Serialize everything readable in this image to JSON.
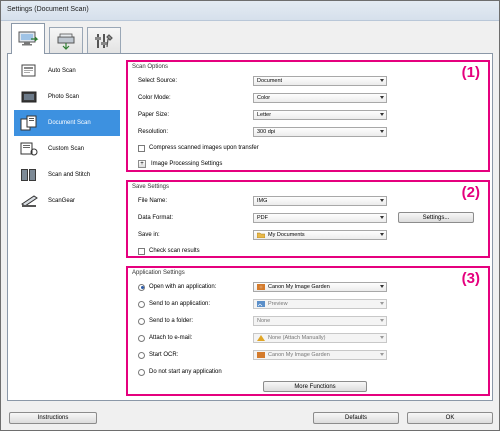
{
  "window": {
    "title": "Settings (Document Scan)"
  },
  "tabs": [
    {
      "icon": "scan-from-computer-icon",
      "active": true
    },
    {
      "icon": "scan-from-panel-icon",
      "active": false
    },
    {
      "icon": "general-settings-icon",
      "active": false
    }
  ],
  "sidebar": {
    "items": [
      {
        "label": "Auto Scan",
        "icon": "auto-scan-icon",
        "selected": false
      },
      {
        "label": "Photo Scan",
        "icon": "photo-scan-icon",
        "selected": false
      },
      {
        "label": "Document Scan",
        "icon": "document-scan-icon",
        "selected": true
      },
      {
        "label": "Custom Scan",
        "icon": "custom-scan-icon",
        "selected": false
      },
      {
        "label": "Scan and Stitch",
        "icon": "scan-and-stitch-icon",
        "selected": false
      },
      {
        "label": "ScanGear",
        "icon": "scangear-icon",
        "selected": false
      }
    ]
  },
  "scan_options": {
    "title": "Scan Options",
    "number": "(1)",
    "select_source": {
      "label": "Select Source:",
      "value": "Document"
    },
    "color_mode": {
      "label": "Color Mode:",
      "value": "Color"
    },
    "paper_size": {
      "label": "Paper Size:",
      "value": "Letter"
    },
    "resolution": {
      "label": "Resolution:",
      "value": "300 dpi"
    },
    "compress_label": "Compress scanned images upon transfer",
    "image_processing_label": "Image Processing Settings",
    "plus_glyph": "+"
  },
  "save_settings": {
    "title": "Save Settings",
    "number": "(2)",
    "file_name": {
      "label": "File Name:",
      "value": "IMG"
    },
    "data_format": {
      "label": "Data Format:",
      "value": "PDF"
    },
    "settings_button": "Settings...",
    "save_in": {
      "label": "Save in:",
      "value": "My Documents"
    },
    "check_results_label": "Check scan results"
  },
  "app_settings": {
    "title": "Application Settings",
    "number": "(3)",
    "options": [
      {
        "label": "Open with an application:",
        "value": "Canon My Image Garden",
        "selected": true,
        "enabled": true,
        "icon": "image-garden-icon"
      },
      {
        "label": "Send to an application:",
        "value": "Preview",
        "selected": false,
        "enabled": false,
        "icon": "preview-app-icon"
      },
      {
        "label": "Send to a folder:",
        "value": "None",
        "selected": false,
        "enabled": false,
        "icon": ""
      },
      {
        "label": "Attach to e-mail:",
        "value": "None (Attach Manually)",
        "selected": false,
        "enabled": false,
        "icon": "mail-icon"
      },
      {
        "label": "Start OCR:",
        "value": "Canon My Image Garden",
        "selected": false,
        "enabled": false,
        "icon": "image-garden-icon"
      }
    ],
    "do_not_start_label": "Do not start any application",
    "more_functions_button": "More Functions"
  },
  "footer": {
    "instructions_button": "Instructions",
    "defaults_button": "Defaults",
    "ok_button": "OK"
  },
  "colors": {
    "highlight": "#e5007e",
    "selection": "#3d91e0"
  }
}
